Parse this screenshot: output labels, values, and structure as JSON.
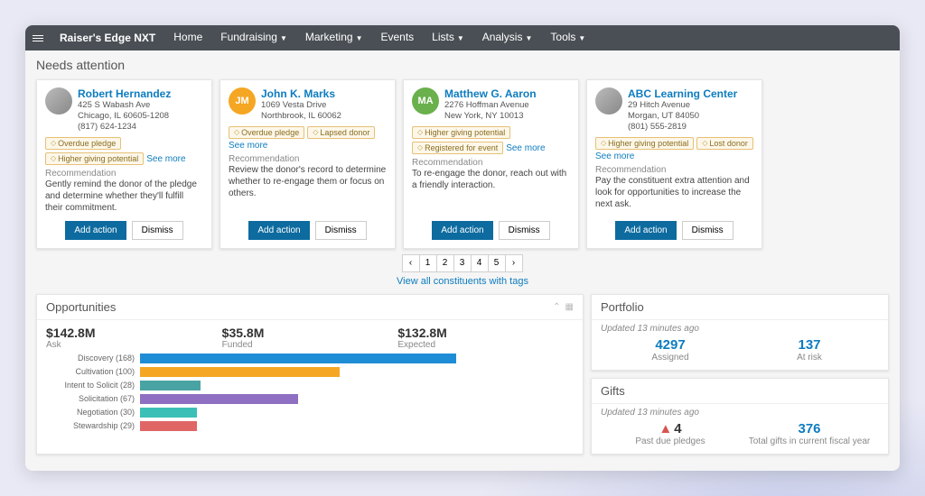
{
  "brand": "Raiser's Edge NXT",
  "nav": [
    "Home",
    "Fundraising",
    "Marketing",
    "Events",
    "Lists",
    "Analysis",
    "Tools"
  ],
  "nav_dropdown": [
    false,
    true,
    true,
    false,
    true,
    true,
    true
  ],
  "sections": {
    "needs_attention": "Needs attention",
    "opportunities": "Opportunities",
    "portfolio": "Portfolio",
    "gifts": "Gifts"
  },
  "labels": {
    "recommendation": "Recommendation",
    "add_action": "Add action",
    "dismiss": "Dismiss",
    "see_more": "See more",
    "view_all": "View all constituents with tags",
    "updated": "Updated 13 minutes ago"
  },
  "cards": [
    {
      "name": "Robert Hernandez",
      "addr1": "425 S Wabash Ave",
      "addr2": "Chicago, IL 60605-1208",
      "phone": "(817) 624-1234",
      "avatar": {
        "type": "img"
      },
      "tags": [
        "Overdue pledge",
        "Higher giving potential"
      ],
      "see_more_inline": true,
      "rec": "Gently remind the donor of the pledge and determine whether they'll fulfill their commitment."
    },
    {
      "name": "John K. Marks",
      "addr1": "1069 Vesta Drive",
      "addr2": "Northbrook, IL 60062",
      "phone": "",
      "avatar": {
        "type": "initials",
        "text": "JM",
        "color": "#f5a623"
      },
      "tags": [
        "Overdue pledge",
        "Lapsed donor"
      ],
      "see_more_block": true,
      "rec": "Review the donor's record to determine whether to re-engage them or focus on others."
    },
    {
      "name": "Matthew G. Aaron",
      "addr1": "2276 Hoffman Avenue",
      "addr2": "New York, NY 10013",
      "phone": "",
      "avatar": {
        "type": "initials",
        "text": "MA",
        "color": "#6ab04c"
      },
      "tags": [
        "Higher giving potential",
        "Registered for event"
      ],
      "see_more_inline": true,
      "rec": "To re-engage the donor, reach out with a friendly interaction."
    },
    {
      "name": "ABC Learning Center",
      "addr1": "29 Hitch Avenue",
      "addr2": "Morgan, UT 84050",
      "phone": "(801) 555-2819",
      "avatar": {
        "type": "img"
      },
      "tags": [
        "Higher giving potential",
        "Lost donor"
      ],
      "see_more_block": true,
      "rec": "Pay the constituent extra attention and look for opportunities to increase the next ask."
    }
  ],
  "pager": [
    "‹",
    "1",
    "2",
    "3",
    "4",
    "5",
    "›"
  ],
  "opp_stats": [
    {
      "value": "$142.8M",
      "label": "Ask"
    },
    {
      "value": "$35.8M",
      "label": "Funded"
    },
    {
      "value": "$132.8M",
      "label": "Expected"
    }
  ],
  "chart_data": {
    "type": "bar",
    "orientation": "horizontal",
    "xlabel": "",
    "ylabel": "",
    "series": [
      {
        "name": "Discovery (168)",
        "value": 168,
        "pct": 100,
        "color": "#1f8dd6"
      },
      {
        "name": "Cultivation (100)",
        "value": 100,
        "pct": 63,
        "color": "#f5a623"
      },
      {
        "name": "Intent to Solicit (28)",
        "value": 28,
        "pct": 19,
        "color": "#4aa3a3"
      },
      {
        "name": "Solicitation (67)",
        "value": 67,
        "pct": 50,
        "color": "#8e6fc1"
      },
      {
        "name": "Negotiation (30)",
        "value": 30,
        "pct": 18,
        "color": "#3bbfb7"
      },
      {
        "name": "Stewardship (29)",
        "value": 29,
        "pct": 18,
        "color": "#e06666"
      }
    ]
  },
  "portfolio": {
    "assigned": {
      "value": "4297",
      "label": "Assigned"
    },
    "at_risk": {
      "value": "137",
      "label": "At risk"
    }
  },
  "gifts": {
    "past_due": {
      "value": "4",
      "label": "Past due pledges"
    },
    "total": {
      "value": "376",
      "label": "Total gifts in current fiscal year"
    }
  }
}
